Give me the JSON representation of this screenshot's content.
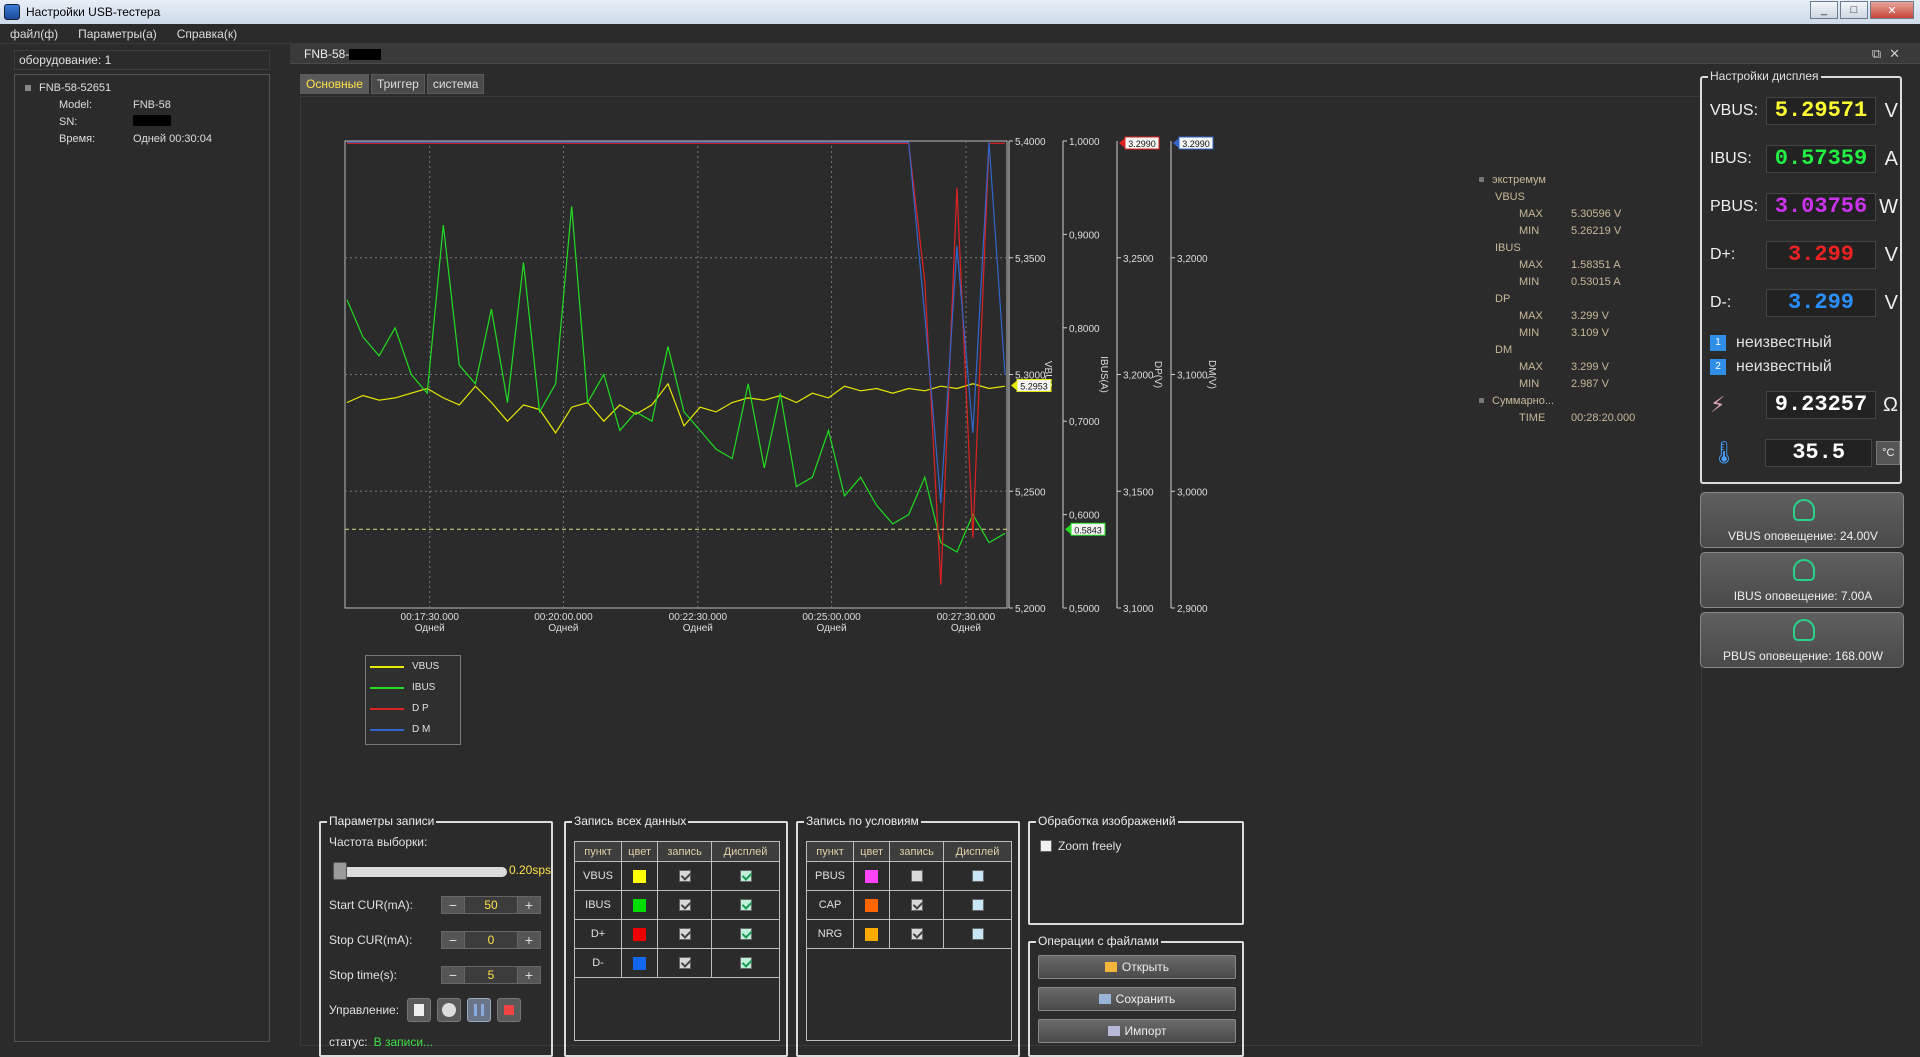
{
  "window": {
    "title": "Настройки USB-тестера"
  },
  "menu": [
    "файл(ф)",
    "Параметры(а)",
    "Справка(к)"
  ],
  "left": {
    "equipment_label": "оборудование: 1",
    "device": "FNB-58-52651",
    "fields": [
      {
        "key": "Model:",
        "value": "FNB-58"
      },
      {
        "key": "SN:",
        "value": ""
      },
      {
        "key": "Время:",
        "value": "Одней 00:30:04"
      }
    ]
  },
  "doc_tab": {
    "label": "FNB-58-"
  },
  "tabs": [
    "Основные",
    "Триггер",
    "система"
  ],
  "chart_data": {
    "type": "line",
    "x_ticks": [
      "00:17:30.000",
      "00:20:00.000",
      "00:22:30.000",
      "00:25:00.000",
      "00:27:30.000"
    ],
    "x_tick_sub": "Одней",
    "axes": {
      "vbus": {
        "label": "VBUS",
        "ticks": [
          "5,4000",
          "5,3500",
          "5,3000",
          "5,2500",
          "5,2000"
        ],
        "range": [
          5.2,
          5.4
        ]
      },
      "ibus": {
        "label": "IBUS(A)",
        "ticks": [
          "1,0000",
          "0,9000",
          "0,8000",
          "0,7000",
          "0,6000",
          "0,5000"
        ],
        "range": [
          0.5,
          1.0
        ]
      },
      "dp": {
        "label": "DP(V)",
        "ticks": [
          "3,2500",
          "3,2000",
          "3,1500",
          "3,1000"
        ],
        "range": [
          3.1,
          3.3
        ]
      },
      "dm": {
        "label": "DM(V)",
        "ticks": [
          "3,2000",
          "3,1000",
          "3,0000",
          "2,9000"
        ],
        "range": [
          2.9,
          3.3
        ]
      }
    },
    "markers": {
      "vbus": "5.2953",
      "ibus": "0.5843",
      "dp": "3.2990",
      "dm": "3.2990"
    },
    "series": [
      {
        "name": "VBUS",
        "color": "#e8e800",
        "axis": "vbus",
        "values": [
          5.288,
          5.291,
          5.289,
          5.29,
          5.292,
          5.294,
          5.29,
          5.287,
          5.295,
          5.288,
          5.28,
          5.287,
          5.285,
          5.275,
          5.286,
          5.288,
          5.28,
          5.287,
          5.283,
          5.287,
          5.296,
          5.278,
          5.286,
          5.284,
          5.288,
          5.29,
          5.289,
          5.291,
          5.288,
          5.292,
          5.29,
          5.295,
          5.293,
          5.294,
          5.292,
          5.294,
          5.293,
          5.295,
          5.294,
          5.296,
          5.294,
          5.295
        ]
      },
      {
        "name": "IBUS",
        "color": "#22dd22",
        "axis": "ibus",
        "values": [
          0.83,
          0.79,
          0.77,
          0.8,
          0.75,
          0.73,
          0.91,
          0.76,
          0.74,
          0.82,
          0.72,
          0.87,
          0.71,
          0.74,
          0.93,
          0.72,
          0.75,
          0.69,
          0.71,
          0.7,
          0.78,
          0.71,
          0.69,
          0.67,
          0.66,
          0.74,
          0.65,
          0.73,
          0.63,
          0.64,
          0.69,
          0.62,
          0.64,
          0.61,
          0.59,
          0.6,
          0.64,
          0.57,
          0.56,
          0.6,
          0.57,
          0.58
        ]
      },
      {
        "name": "D P",
        "color": "#dd2222",
        "axis": "dp",
        "values": [
          3.299,
          3.299,
          3.299,
          3.299,
          3.299,
          3.299,
          3.299,
          3.299,
          3.299,
          3.299,
          3.299,
          3.299,
          3.299,
          3.299,
          3.299,
          3.299,
          3.299,
          3.299,
          3.299,
          3.299,
          3.299,
          3.299,
          3.299,
          3.299,
          3.299,
          3.299,
          3.299,
          3.299,
          3.299,
          3.299,
          3.299,
          3.299,
          3.299,
          3.299,
          3.299,
          3.299,
          3.24,
          3.11,
          3.28,
          3.13,
          3.299,
          3.299
        ]
      },
      {
        "name": "D M",
        "color": "#3366cc",
        "axis": "dm",
        "values": [
          3.299,
          3.299,
          3.299,
          3.299,
          3.299,
          3.299,
          3.299,
          3.299,
          3.299,
          3.299,
          3.299,
          3.299,
          3.299,
          3.299,
          3.299,
          3.299,
          3.299,
          3.299,
          3.299,
          3.299,
          3.299,
          3.299,
          3.299,
          3.299,
          3.299,
          3.299,
          3.299,
          3.299,
          3.299,
          3.299,
          3.299,
          3.299,
          3.299,
          3.299,
          3.299,
          3.299,
          3.15,
          2.99,
          3.21,
          3.05,
          3.299,
          3.1
        ]
      }
    ]
  },
  "extrema": [
    {
      "level": 0,
      "label": "экстремум",
      "value": ""
    },
    {
      "level": 1,
      "label": "VBUS",
      "value": ""
    },
    {
      "level": 2,
      "label": "MAX",
      "value": "5.30596 V"
    },
    {
      "level": 2,
      "label": "MIN",
      "value": "5.26219 V"
    },
    {
      "level": 1,
      "label": "IBUS",
      "value": ""
    },
    {
      "level": 2,
      "label": "MAX",
      "value": "1.58351 A"
    },
    {
      "level": 2,
      "label": "MIN",
      "value": "0.53015 A"
    },
    {
      "level": 1,
      "label": "DP",
      "value": ""
    },
    {
      "level": 2,
      "label": "MAX",
      "value": "3.299 V"
    },
    {
      "level": 2,
      "label": "MIN",
      "value": "3.109 V"
    },
    {
      "level": 1,
      "label": "DM",
      "value": ""
    },
    {
      "level": 2,
      "label": "MAX",
      "value": "3.299 V"
    },
    {
      "level": 2,
      "label": "MIN",
      "value": "2.987 V"
    },
    {
      "level": 0,
      "label": "Суммарно...",
      "value": ""
    },
    {
      "level": 2,
      "label": "TIME",
      "value": "00:28:20.000"
    }
  ],
  "record_params": {
    "title": "Параметры записи",
    "rate_label": "Частота выборки:",
    "rate_value": "0.20sps",
    "start_label": "Start CUR(mA):",
    "start_value": "50",
    "stop_label": "Stop CUR(mA):",
    "stop_value": "0",
    "time_label": "Stop time(s):",
    "time_value": "5",
    "control_label": "Управление:",
    "status_label": "статус:",
    "status_value": "В записи..."
  },
  "record_all": {
    "title": "Запись всех данных",
    "headers": [
      "пункт",
      "цвет",
      "запись",
      "Дисплей"
    ],
    "rows": [
      {
        "item": "VBUS",
        "color": "#ffff00",
        "record": true,
        "display": true
      },
      {
        "item": "IBUS",
        "color": "#00dd00",
        "record": true,
        "display": true
      },
      {
        "item": "D+",
        "color": "#ee0000",
        "record": true,
        "display": true
      },
      {
        "item": "D-",
        "color": "#1166ee",
        "record": true,
        "display": true
      }
    ]
  },
  "record_cond": {
    "title": "Запись по условиям",
    "headers": [
      "пункт",
      "цвет",
      "запись",
      "Дисплей"
    ],
    "rows": [
      {
        "item": "PBUS",
        "color": "#ff44ff",
        "record": false,
        "display": false
      },
      {
        "item": "CAP",
        "color": "#ff6600",
        "record": true,
        "display": false
      },
      {
        "item": "NRG",
        "color": "#ffaa00",
        "record": true,
        "display": false
      }
    ]
  },
  "image_proc": {
    "title": "Обработка изображений",
    "zoom_label": "Zoom freely"
  },
  "file_ops": {
    "title": "Операции с файлами",
    "open": "Открыть",
    "save": "Сохранить",
    "import": "Импорт"
  },
  "display": {
    "title": "Настройки дисплея",
    "vbus": {
      "label": "VBUS:",
      "value": "5.29571",
      "unit": "V",
      "color": "#ffff33"
    },
    "ibus": {
      "label": "IBUS:",
      "value": "0.57359",
      "unit": "A",
      "color": "#22ee44"
    },
    "pbus": {
      "label": "PBUS:",
      "value": "3.03756",
      "unit": "W",
      "color": "#cc33ee"
    },
    "dp": {
      "label": "D+:",
      "value": "3.299",
      "unit": "V",
      "color": "#ee2222"
    },
    "dm": {
      "label": "D-:",
      "value": "3.299",
      "unit": "V",
      "color": "#2a8fff"
    },
    "proto1": {
      "badge": "1",
      "text": "неизвестный"
    },
    "proto2": {
      "badge": "2",
      "text": "неизвестный"
    },
    "resistance": {
      "value": "9.23257",
      "unit": "Ω"
    },
    "temperature": {
      "value": "35.5",
      "unit": "°C"
    }
  },
  "alerts": [
    "VBUS оповещение: 24.00V",
    "IBUS оповещение: 7.00A",
    "PBUS оповещение: 168.00W"
  ]
}
